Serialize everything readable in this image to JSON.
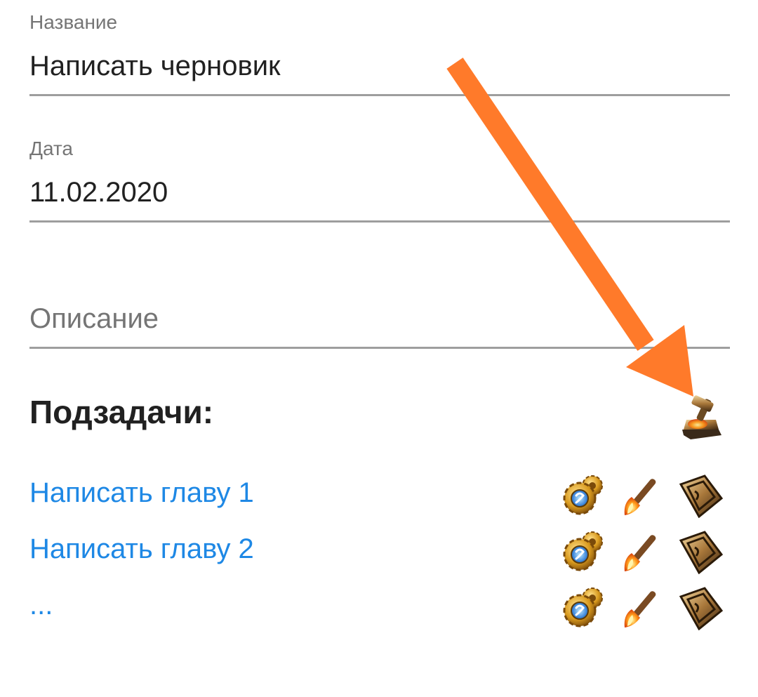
{
  "form": {
    "title_label": "Название",
    "title_value": "Написать черновик",
    "date_label": "Дата",
    "date_value": "11.02.2020",
    "description_placeholder": "Описание"
  },
  "subtasks": {
    "heading": "Подзадачи:",
    "add_icon": "anvil-hammer-icon",
    "items": [
      {
        "label": "Написать главу 1",
        "icons": [
          "gear-icon",
          "brush-icon",
          "arrow-icon"
        ]
      },
      {
        "label": "Написать главу 2",
        "icons": [
          "gear-icon",
          "brush-icon",
          "arrow-icon"
        ]
      },
      {
        "label": "...",
        "icons": [
          "gear-icon",
          "brush-icon",
          "arrow-icon"
        ]
      }
    ]
  },
  "colors": {
    "link": "#1e88e5",
    "annotation_arrow": "#ff7a2a",
    "divider": "#9e9e9e"
  }
}
